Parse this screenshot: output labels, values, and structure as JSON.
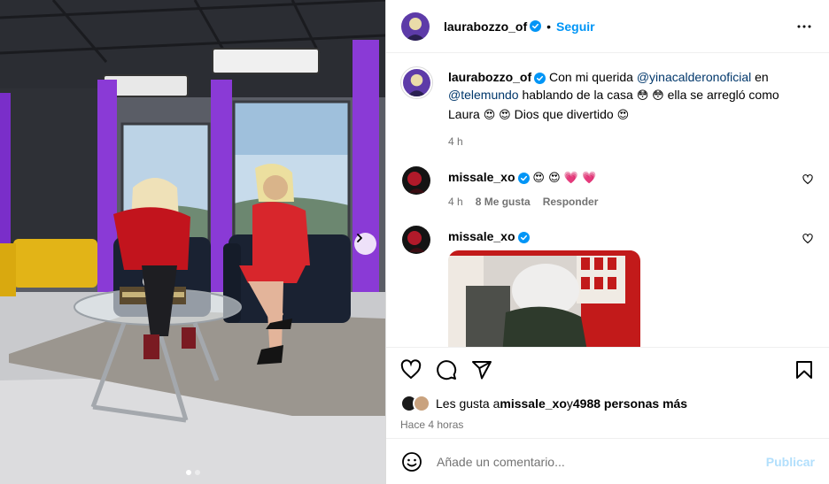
{
  "post": {
    "author": "laurabozzo_of",
    "follow_label": "Seguir",
    "separator": "•"
  },
  "caption": {
    "author": "laurabozzo_of",
    "text_1": "Con mi querida ",
    "mention_1": "@yinacalderonoficial",
    "text_2": " en",
    "mention_2": "@telemundo",
    "text_3": " hablando de la casa ",
    "emoji_a": "😳",
    "emoji_b": "😳",
    "text_4": " ella se arregló como",
    "text_5": "Laura ",
    "emoji_c": "😍",
    "emoji_d": "😍",
    "text_6": " Dios que divertido ",
    "emoji_e": "😍",
    "time": "4 h"
  },
  "comments": [
    {
      "author": "missale_xo",
      "text": "😍 😍 💗 💗",
      "time": "4 h",
      "likes": "8 Me gusta",
      "reply_label": "Responder"
    },
    {
      "author": "missale_xo"
    }
  ],
  "likes": {
    "prefix": "Les gusta a ",
    "first_user": "missale_xo",
    "mid": " y ",
    "others": "4988 personas más"
  },
  "timestamp": "Hace 4 horas",
  "composer": {
    "placeholder": "Añade un comentario...",
    "publish_label": "Publicar"
  },
  "carousel": {
    "current": 1,
    "total": 2
  },
  "colors": {
    "accent": "#0095f6",
    "verified": "#0095f6",
    "publish_disabled": "#b2dffc",
    "heart_emoji": "#e0245e"
  }
}
